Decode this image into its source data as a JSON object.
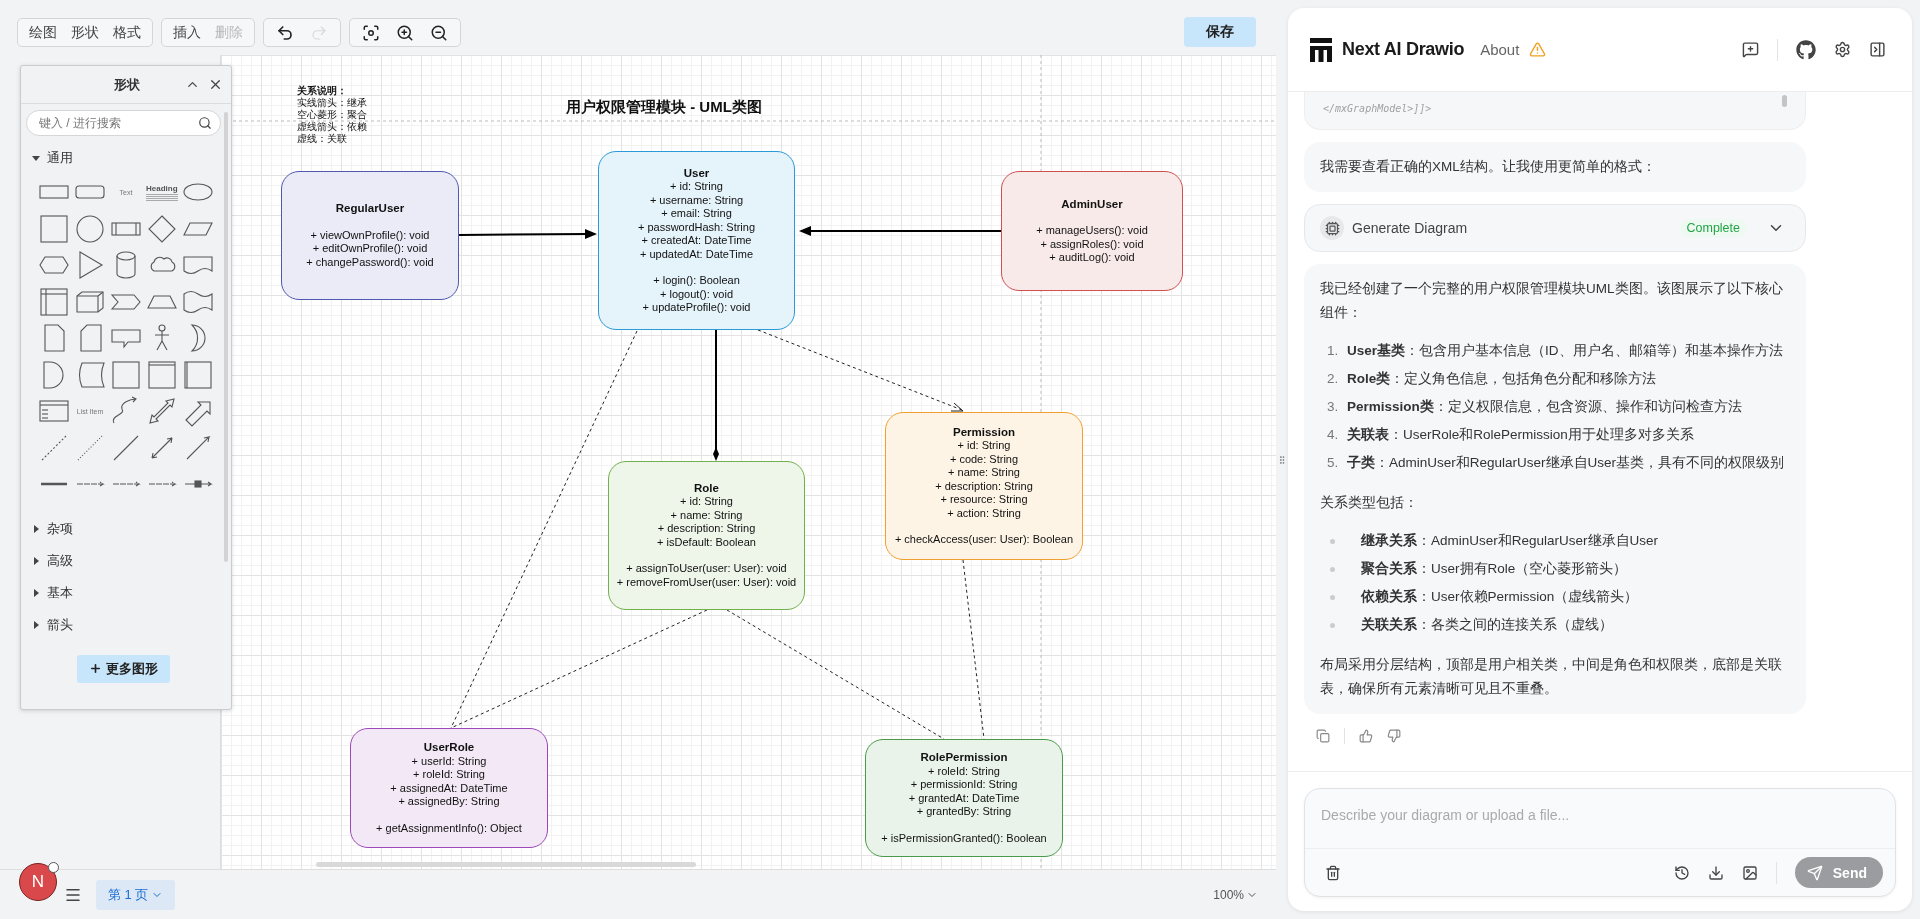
{
  "toolbar": {
    "menu_groups": [
      [
        {
          "label": "绘图",
          "disabled": false
        },
        {
          "label": "形状",
          "disabled": false
        },
        {
          "label": "格式",
          "disabled": false
        }
      ],
      [
        {
          "label": "插入",
          "disabled": false
        },
        {
          "label": "删除",
          "disabled": true
        }
      ]
    ],
    "history": [
      {
        "kind": "undo",
        "disabled": false
      },
      {
        "kind": "redo",
        "disabled": true
      }
    ],
    "view_tools": [
      {
        "kind": "fit"
      },
      {
        "kind": "zoom-in"
      },
      {
        "kind": "zoom-out"
      }
    ],
    "save": "保存"
  },
  "shapes_panel": {
    "title": "形状",
    "search": {
      "placeholder": "键入 / 进行搜索"
    },
    "sections": [
      {
        "label": "通用",
        "expanded": true,
        "shapes": [
          {
            "kind": "rectangle"
          },
          {
            "kind": "rounded-rectangle"
          },
          {
            "kind": "text",
            "label": "Text"
          },
          {
            "kind": "heading",
            "label": "Heading"
          },
          {
            "kind": "ellipse"
          },
          {
            "kind": "square"
          },
          {
            "kind": "circle"
          },
          {
            "kind": "process"
          },
          {
            "kind": "diamond"
          },
          {
            "kind": "parallelogram"
          },
          {
            "kind": "hexagon"
          },
          {
            "kind": "triangle"
          },
          {
            "kind": "cylinder"
          },
          {
            "kind": "cloud"
          },
          {
            "kind": "document"
          },
          {
            "kind": "internal-storage"
          },
          {
            "kind": "cube"
          },
          {
            "kind": "step"
          },
          {
            "kind": "trapezoid"
          },
          {
            "kind": "tape"
          },
          {
            "kind": "note"
          },
          {
            "kind": "card"
          },
          {
            "kind": "callout"
          },
          {
            "kind": "actor"
          },
          {
            "kind": "crescent"
          },
          {
            "kind": "half-round"
          },
          {
            "kind": "data-storage"
          },
          {
            "kind": "square"
          },
          {
            "kind": "frame"
          },
          {
            "kind": "container"
          },
          {
            "kind": "list"
          },
          {
            "kind": "list-item",
            "label": "List Item"
          },
          {
            "kind": "curve"
          },
          {
            "kind": "double-block-arrow"
          },
          {
            "kind": "block-arrow"
          },
          {
            "kind": "dashed-line"
          },
          {
            "kind": "dotted-line"
          },
          {
            "kind": "line"
          },
          {
            "kind": "double-arrow-line"
          },
          {
            "kind": "arrow-line"
          },
          {
            "kind": "thick-line"
          },
          {
            "kind": "labeled-connector"
          },
          {
            "kind": "labeled-connector"
          },
          {
            "kind": "labeled-connector"
          },
          {
            "kind": "icon-connector"
          }
        ]
      },
      {
        "label": "杂项",
        "expanded": false
      },
      {
        "label": "高级",
        "expanded": false
      },
      {
        "label": "基本",
        "expanded": false
      },
      {
        "label": "箭头",
        "expanded": false
      }
    ],
    "more_button": "更多图形"
  },
  "diagram": {
    "title": "用户权限管理模块 - UML类图",
    "legend": {
      "heading": "关系说明：",
      "lines": [
        "实线箭头：继承",
        "空心菱形：聚合",
        "虚线箭头：依赖",
        "虚线：关联"
      ]
    },
    "classes": [
      {
        "name": "RegularUser",
        "color": "#5058b0",
        "methods": [
          "+ viewOwnProfile(): void",
          "+ editOwnProfile(): void",
          "+ changePassword(): void"
        ]
      },
      {
        "name": "User",
        "color": "#2a9ad8",
        "attributes": [
          "+ id: String",
          "+ username: String",
          "+ email: String",
          "+ passwordHash: String",
          "+ createdAt: DateTime",
          "+ updatedAt: DateTime"
        ],
        "methods": [
          "+ login(): Boolean",
          "+ logout(): void",
          "+ updateProfile(): void"
        ]
      },
      {
        "name": "AdminUser",
        "color": "#d05050",
        "methods": [
          "+ manageUsers(): void",
          "+ assignRoles(): void",
          "+ auditLog(): void"
        ]
      },
      {
        "name": "Role",
        "color": "#72b04c",
        "attributes": [
          "+ id: String",
          "+ name: String",
          "+ description: String",
          "+ isDefault: Boolean"
        ],
        "methods": [
          "+ assignToUser(user: User): void",
          "+ removeFromUser(user: User): void"
        ]
      },
      {
        "name": "Permission",
        "color": "#f0a030",
        "attributes": [
          "+ id: String",
          "+ code: String",
          "+ name: String",
          "+ description: String",
          "+ resource: String",
          "+ action: String"
        ],
        "methods": [
          "+ checkAccess(user: User): Boolean"
        ]
      },
      {
        "name": "UserRole",
        "color": "#9c48b8",
        "attributes": [
          "+ userId: String",
          "+ roleId: String",
          "+ assignedAt: DateTime",
          "+ assignedBy: String"
        ],
        "methods": [
          "+ getAssignmentInfo(): Object"
        ]
      },
      {
        "name": "RolePermission",
        "color": "#4a9a4a",
        "attributes": [
          "+ roleId: String",
          "+ permissionId: String",
          "+ grantedAt: DateTime",
          "+ grantedBy: String"
        ],
        "methods": [
          "+ isPermissionGranted(): Boolean"
        ]
      }
    ]
  },
  "avatar": "N",
  "pages": [
    {
      "label": "第 1 页",
      "selected": true
    }
  ],
  "zoom": "100%",
  "chat": {
    "app_name": "Next AI Drawio",
    "about": "About",
    "code_tail": "</mxGraphModel>]]>",
    "messages": [
      {
        "kind": "text",
        "text": "我需要查看正确的XML结构。让我使用更简单的格式："
      },
      {
        "kind": "tool",
        "name": "Generate Diagram",
        "status": "Complete",
        "expanded": false
      },
      {
        "kind": "rich",
        "intro": "我已经创建了一个完整的用户权限管理模块UML类图。该图展示了以下核心组件：",
        "numbered": [
          {
            "number": "1.",
            "text": "**User基类**：包含用户基本信息（ID、用户名、邮箱等）和基本操作方法"
          },
          {
            "number": "2.",
            "text": "**Role类**：定义角色信息，包括角色分配和移除方法"
          },
          {
            "number": "3.",
            "text": "**Permission类**：定义权限信息，包含资源、操作和访问检查方法"
          },
          {
            "number": "4.",
            "text": "**关联表**：UserRole和RolePermission用于处理多对多关系"
          },
          {
            "number": "5.",
            "text": "**子类**：AdminUser和RegularUser继承自User基类，具有不同的权限级别"
          }
        ],
        "subheading": "关系类型包括：",
        "bullets": [
          "**继承关系**：AdminUser和RegularUser继承自User",
          "**聚合关系**：User拥有Role（空心菱形箭头）",
          "**依赖关系**：User依赖Permission（虚线箭头）",
          "**关联关系**：各类之间的连接关系（虚线）"
        ],
        "outro": "布局采用分层结构，顶部是用户相关类，中间是角色和权限类，底部是关联表，确保所有元素清晰可见且不重叠。"
      }
    ],
    "input": {
      "placeholder": "Describe your diagram or upload a file...",
      "send": "Send"
    }
  }
}
